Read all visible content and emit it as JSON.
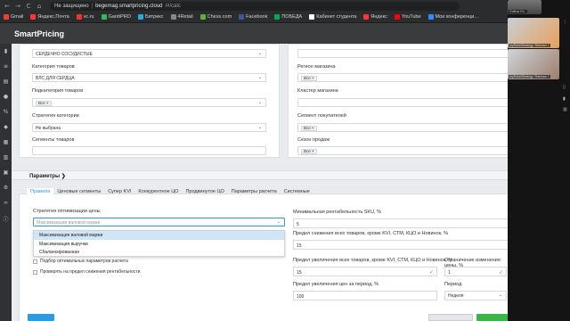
{
  "browser": {
    "back": "←",
    "forward": "→",
    "reload": "C",
    "home": "⌂",
    "security_label": "Не защищено",
    "separator": "|",
    "url_host": "begemag.smartpricing.cloud",
    "url_path": "/#/calc"
  },
  "bookmarks": [
    {
      "label": "Gmail",
      "color": "#e94235"
    },
    {
      "label": "Яндекс.Почта",
      "color": "#f33"
    },
    {
      "label": "vc.ru",
      "color": "#e33"
    },
    {
      "label": "GanttPRO",
      "color": "#3b5"
    },
    {
      "label": "Битрикс",
      "color": "#2fa6e0"
    },
    {
      "label": "4Retail",
      "color": "#888"
    },
    {
      "label": "Chess.com",
      "color": "#6a4"
    },
    {
      "label": "Facebook",
      "color": "#3b5998"
    },
    {
      "label": "ПОБЕДА",
      "color": "#0a5"
    },
    {
      "label": "Кабинет студента",
      "color": "#fff"
    },
    {
      "label": "Яндекс",
      "color": "#f33"
    },
    {
      "label": "YouTube",
      "color": "#f00"
    },
    {
      "label": "Мои конференци...",
      "color": "#2d8cff"
    }
  ],
  "app": {
    "title": "SmartPricing"
  },
  "filters_left": {
    "group_value": "СЕРДЕЧНО СОСУДИСТЫЕ",
    "category_label": "Категория товаров",
    "category_value": "ВЛС ДЛЯ СЕРДЦА",
    "subcategory_label": "Подкатегория товаров",
    "subcategory_chip": "Все ×",
    "strategy_label": "Стратегия категории",
    "strategy_value": "Не выбрана",
    "segments_label": "Сегменты товаров"
  },
  "filters_right": {
    "region_label": "Регион магазина",
    "region_chip": "Все ×",
    "cluster_label": "Кластер магазина",
    "buyers_label": "Сегмент покупателей",
    "buyers_chip": "Все ×",
    "season_label": "Сезон продаж",
    "season_chip": "Все ×"
  },
  "params": {
    "title": "Параметры ❯"
  },
  "tabs": [
    {
      "label": "Правила",
      "active": true
    },
    {
      "label": "Ценовые сегменты"
    },
    {
      "label": "Супер KVI"
    },
    {
      "label": "Конкурентное ЦО"
    },
    {
      "label": "Продвинутое ЦО"
    },
    {
      "label": "Параметры расчета"
    },
    {
      "label": "Системные"
    }
  ],
  "optimization": {
    "label": "Стратегия оптимизации цены",
    "placeholder": "Максимизация валовой маржи",
    "options": [
      "Максимизация валовой маржи",
      "Максимизация выручки",
      "Сбалансированная"
    ],
    "checkbox1": "Подбор оптимальных параметров расчета",
    "checkbox2": "Проверять на предел снижения рентабельности"
  },
  "right_fields": {
    "min_margin_label": "Минимальная рентабельность SKU, %",
    "min_margin_value": "5",
    "max_decrease_label": "Предел снижения всех товаров, кроме KVI, СТМ, КЦО и Новинок, %",
    "max_decrease_value": "15",
    "max_increase_label": "Предел увеличения всех товаров, кроме KVI, СТМ, КЦО и Новинок, %",
    "max_increase_value": "15",
    "limit_change_label": "Ограничение изменения цены, %",
    "limit_change_value": "1",
    "period_increase_label": "Предел увеличения цен за период, %",
    "period_increase_value": "100",
    "period_label": "Период",
    "period_value": "Неделя"
  },
  "video": {
    "tag1": "Gulfraz Kh...",
    "tag2": "myRetailStrategy: Rahman I.",
    "tag3": "myRetailStrategy: Rahman I."
  },
  "colors": {
    "accent": "#2f9ae0",
    "green": "#3cb44b",
    "teal": "#29b6d8"
  }
}
